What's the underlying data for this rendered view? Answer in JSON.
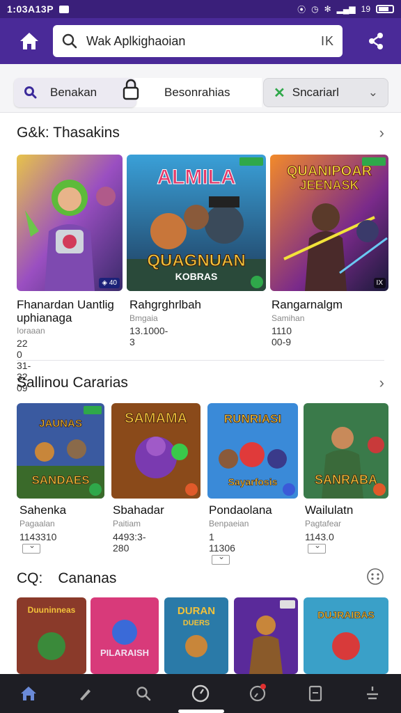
{
  "status_bar": {
    "time": "1:03A13P",
    "battery": "19"
  },
  "app_bar": {
    "search_value": "Wak Aplkighaoian",
    "search_ext": "IK"
  },
  "filters": {
    "left": "Benakan",
    "middle": "Besonrahias",
    "right": "Sncariarl"
  },
  "sections": [
    {
      "title": "G&k: Thasakins",
      "items": [
        {
          "title": "Fhanardan Uantlig uphianaga",
          "sub": "Ioraaan",
          "meta": "22 0 31-32 09"
        },
        {
          "title": "Rahgrghrlbah",
          "sub": "Bmgaia",
          "meta": "13.1000-3"
        },
        {
          "title": "Rangarnalgm",
          "sub": "Samihan",
          "meta": "1110 00-9"
        }
      ]
    },
    {
      "title": "Sallinou Cararias",
      "items": [
        {
          "title": "Sahenka",
          "sub": "Pagaalan",
          "meta": "1143310"
        },
        {
          "title": "Sbahadar",
          "sub": "Paitiam",
          "meta": "4493:3-280"
        },
        {
          "title": "Pondaolana",
          "sub": "Benpaeian",
          "meta": "1 11306"
        },
        {
          "title": "Wailulatn",
          "sub": "Pagtafear",
          "meta": "1143.0"
        }
      ]
    },
    {
      "title_prefix": "CQ:",
      "title": "Cananas"
    }
  ],
  "thumb_text": {
    "t1": "ALMILA",
    "t1b": "QUAGNUAN",
    "t1c": "KOBRAS",
    "t2": "QUANIPOAR",
    "t2b": "JEENASK",
    "r1": "JAUNAS",
    "r1b": "SANDAES",
    "r2": "SAMAMA",
    "r3": "RUNRIASI",
    "r3b": "Sayarfosis",
    "r4": "SANRABA",
    "b1": "Duuninneas",
    "b2": "PILARAISH",
    "b3": "DURAN",
    "b3b": "DUERS",
    "b5": "DUJRAIBAS"
  },
  "colors": {
    "status_bar": "#3a1f7a",
    "app_bar": "#4a2a98",
    "bottom_nav": "#1e1e24",
    "accent_green": "#2fa84a"
  },
  "bottom_nav": [
    "home-icon",
    "pen-icon",
    "search-icon",
    "timer-icon",
    "target-icon",
    "book-icon",
    "menu-icon"
  ]
}
